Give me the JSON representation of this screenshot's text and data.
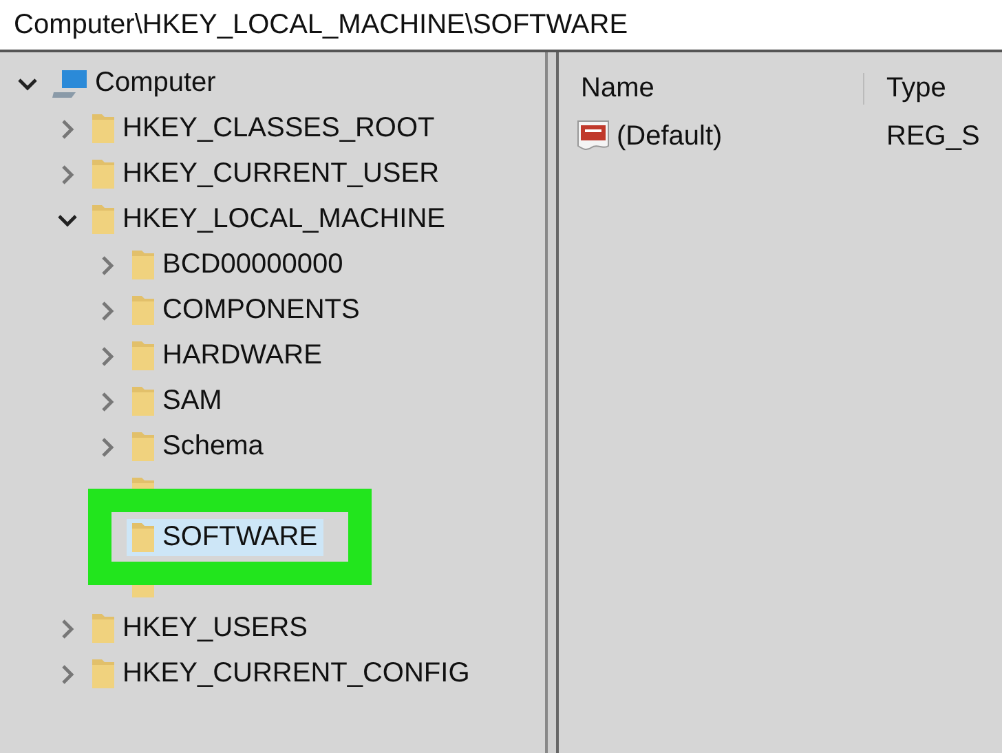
{
  "address_bar": "Computer\\HKEY_LOCAL_MACHINE\\SOFTWARE",
  "tree": [
    {
      "label": "Computer",
      "kind": "computer",
      "expanded": true,
      "selected": false,
      "children": [
        {
          "label": "HKEY_CLASSES_ROOT",
          "kind": "folder",
          "expanded": false,
          "selected": false
        },
        {
          "label": "HKEY_CURRENT_USER",
          "kind": "folder",
          "expanded": false,
          "selected": false
        },
        {
          "label": "HKEY_LOCAL_MACHINE",
          "kind": "folder",
          "expanded": true,
          "selected": false,
          "children": [
            {
              "label": "BCD00000000",
              "kind": "folder",
              "expanded": false,
              "selected": false
            },
            {
              "label": "COMPONENTS",
              "kind": "folder",
              "expanded": false,
              "selected": false
            },
            {
              "label": "HARDWARE",
              "kind": "folder",
              "expanded": false,
              "selected": false
            },
            {
              "label": "SAM",
              "kind": "folder",
              "expanded": false,
              "selected": false
            },
            {
              "label": "Schema",
              "kind": "folder",
              "expanded": false,
              "selected": false
            },
            {
              "kind": "folder"
            },
            {
              "label": "SOFTWARE",
              "kind": "folder",
              "expanded": false,
              "selected": true,
              "highlighted": true
            },
            {
              "kind": "folder"
            }
          ]
        },
        {
          "label": "HKEY_USERS",
          "kind": "folder",
          "expanded": false,
          "selected": false
        },
        {
          "label": "HKEY_CURRENT_CONFIG",
          "kind": "folder",
          "expanded": false,
          "selected": false
        }
      ]
    }
  ],
  "values": {
    "columns": [
      "Name",
      "Type"
    ],
    "rows": [
      {
        "name": "(Default)",
        "type": "REG_S"
      }
    ]
  }
}
